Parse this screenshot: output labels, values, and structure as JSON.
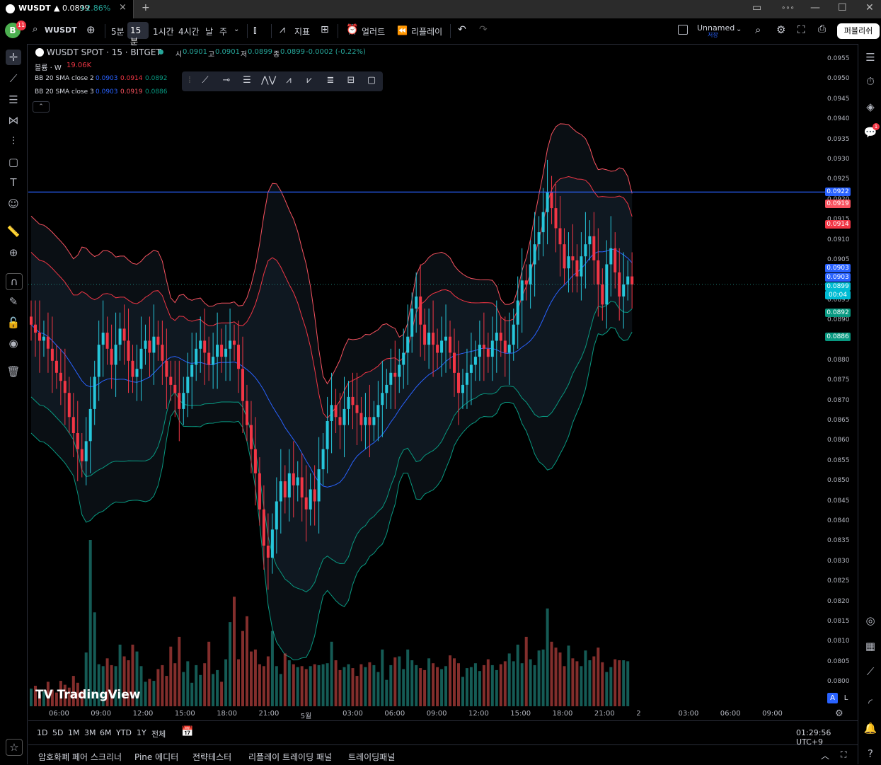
{
  "window": {
    "tab_symbol": "WUSDT",
    "tab_price": "▲ 0.0899",
    "tab_change": "+2.86%",
    "close_icon": "×",
    "new_tab": "+",
    "minimize": "—",
    "maximize": "☐",
    "close": "✕"
  },
  "toolbar": {
    "avatar_letter": "B",
    "avatar_badge": "11",
    "symbol": "WUSDT",
    "timeframes": [
      "5분",
      "15분",
      "1시간",
      "4시간",
      "날",
      "주"
    ],
    "indicators_label": "지표",
    "alert_label": "얼러트",
    "replay_label": "리플레이",
    "layout_name": "Unnamed",
    "layout_status": "저장",
    "publish_label": "퍼블리쉬"
  },
  "legend": {
    "title": "WUSDT SPOT · 15 · BITGET",
    "open_label": "시",
    "open": "0.0901",
    "high_label": "고",
    "high": "0.0901",
    "low_label": "저",
    "low": "0.0899",
    "close_label": "종",
    "close": "0.0899",
    "change": "-0.0002 (-0.22%)",
    "volume_label": "볼륨 · W",
    "volume_value": "19.06K",
    "bb2_label": "BB 20 SMA close 2",
    "bb2_values": [
      "0.0903",
      "0.0914",
      "0.0892"
    ],
    "bb3_label": "BB 20 SMA close 3",
    "bb3_values": [
      "0.0903",
      "0.0919",
      "0.0886"
    ],
    "collapse_icon": "⌃"
  },
  "price_axis": {
    "labels": [
      "0.0955",
      "0.0950",
      "0.0945",
      "0.0940",
      "0.0935",
      "0.0930",
      "0.0925",
      "0.0920",
      "0.0915",
      "0.0910",
      "0.0905",
      "0.0900",
      "0.0895",
      "0.0890",
      "0.0885",
      "0.0880",
      "0.0875",
      "0.0870",
      "0.0865",
      "0.0860",
      "0.0855",
      "0.0850",
      "0.0845",
      "0.0840",
      "0.0835",
      "0.0830",
      "0.0825",
      "0.0820",
      "0.0815",
      "0.0810",
      "0.0805",
      "0.0800"
    ],
    "tags": [
      {
        "value": "0.0922",
        "color": "#2962ff"
      },
      {
        "value": "0.0919",
        "color": "#f7525f"
      },
      {
        "value": "0.0914",
        "color": "#f23645"
      },
      {
        "value": "0.0903",
        "color": "#2962ff"
      },
      {
        "value": "0.0903",
        "color": "#2962ff"
      },
      {
        "value": "0.0899",
        "color": "#00bcd4"
      },
      {
        "value": "0.0892",
        "color": "#089981"
      },
      {
        "value": "0.0886",
        "color": "#089981"
      }
    ],
    "countdown": "00:04"
  },
  "time_axis": [
    "06:00",
    "09:00",
    "12:00",
    "15:00",
    "18:00",
    "21:00",
    "5월",
    "03:00",
    "06:00",
    "09:00",
    "12:00",
    "15:00",
    "18:00",
    "21:00",
    "2",
    "03:00",
    "06:00",
    "09:00"
  ],
  "range_bar": {
    "ranges": [
      "1D",
      "5D",
      "1M",
      "3M",
      "6M",
      "YTD",
      "1Y",
      "전체"
    ],
    "clock": "01:29:56 UTC+9",
    "auto_label": "A",
    "log_label": "L"
  },
  "bottom_panel": {
    "tabs": [
      "암호화폐 페어 스크리너",
      "Pine 에디터",
      "전략테스터",
      "리플레이 트레이딩 패널",
      "트레이딩패널"
    ]
  },
  "branding": {
    "logo": "TradingView"
  },
  "chart_data": {
    "type": "candlestick",
    "symbol": "WUSDT",
    "interval": "15",
    "ylim": [
      0.0798,
      0.0958
    ],
    "horizontal_line": 0.0922,
    "last_price": 0.0899,
    "colors": {
      "up": "#26a69a",
      "down": "#ef5350",
      "up_candle": "#26c6da",
      "down_candle": "#f23645",
      "basis": "#2962ff",
      "upper2": "#f23645",
      "upper3": "#f7525f",
      "lower2": "#089981",
      "lower3": "#089981"
    },
    "closes": [
      0.0889,
      0.0887,
      0.0885,
      0.0886,
      0.0883,
      0.088,
      0.0877,
      0.0875,
      0.0872,
      0.0866,
      0.0862,
      0.0858,
      0.0855,
      0.086,
      0.0868,
      0.0876,
      0.0884,
      0.0887,
      0.0883,
      0.0879,
      0.0884,
      0.0888,
      0.0885,
      0.088,
      0.0876,
      0.0878,
      0.0883,
      0.0885,
      0.0882,
      0.0886,
      0.0884,
      0.088,
      0.0876,
      0.0874,
      0.0872,
      0.0868,
      0.0872,
      0.0876,
      0.0879,
      0.0883,
      0.0885,
      0.0882,
      0.0879,
      0.0881,
      0.0884,
      0.0881,
      0.0883,
      0.0885,
      0.0884,
      0.0878,
      0.087,
      0.0864,
      0.0858,
      0.0852,
      0.0843,
      0.0834,
      0.0831,
      0.0838,
      0.0845,
      0.085,
      0.0846,
      0.0852,
      0.0849,
      0.0851,
      0.0846,
      0.0843,
      0.0848,
      0.0845,
      0.0853,
      0.0858,
      0.0865,
      0.0869,
      0.0866,
      0.0864,
      0.0868,
      0.0871,
      0.0869,
      0.0867,
      0.0864,
      0.0866,
      0.0864,
      0.0866,
      0.0869,
      0.0872,
      0.0874,
      0.0877,
      0.0876,
      0.0879,
      0.0882,
      0.0886,
      0.0893,
      0.0896,
      0.0889,
      0.0884,
      0.0887,
      0.0884,
      0.0882,
      0.0885,
      0.0886,
      0.0882,
      0.0877,
      0.0872,
      0.0874,
      0.0877,
      0.0879,
      0.0881,
      0.0884,
      0.0883,
      0.0881,
      0.0885,
      0.0887,
      0.0885,
      0.0882,
      0.0884,
      0.0889,
      0.0895,
      0.09,
      0.0899,
      0.0904,
      0.0909,
      0.0912,
      0.0917,
      0.0922,
      0.0918,
      0.0913,
      0.0909,
      0.0903,
      0.0906,
      0.0905,
      0.0901,
      0.0906,
      0.0909,
      0.0911,
      0.0905,
      0.0899,
      0.0894,
      0.0904,
      0.0908,
      0.0902,
      0.0896,
      0.0899,
      0.0901,
      0.0899
    ],
    "volumes": [
      18,
      21,
      12,
      15,
      25,
      17,
      14,
      26,
      22,
      19,
      31,
      24,
      16,
      55,
      170,
      96,
      43,
      41,
      49,
      42,
      41,
      63,
      51,
      47,
      63,
      56,
      41,
      25,
      28,
      26,
      38,
      42,
      31,
      61,
      44,
      71,
      35,
      46,
      24,
      42,
      32,
      44,
      66,
      33,
      37,
      25,
      48,
      86,
      112,
      48,
      77,
      92,
      56,
      58,
      43,
      41,
      51,
      77,
      41,
      33,
      54,
      47,
      43,
      40,
      41,
      38,
      41,
      43,
      42,
      43,
      44,
      66,
      47,
      37,
      40,
      43,
      39,
      31,
      43,
      40,
      45,
      42,
      35,
      58,
      27,
      42,
      50,
      51,
      38,
      58,
      47,
      42,
      39,
      37,
      49,
      44,
      40,
      38,
      41,
      52,
      49,
      44,
      30,
      39,
      40,
      44,
      36,
      42,
      48,
      42,
      37,
      43,
      46,
      54,
      46,
      63,
      44,
      71,
      48,
      42,
      57,
      58,
      100,
      66,
      60,
      55,
      41,
      62,
      49,
      46,
      41,
      57,
      47,
      51,
      60,
      45,
      35,
      40,
      48,
      47,
      47,
      46
    ]
  }
}
